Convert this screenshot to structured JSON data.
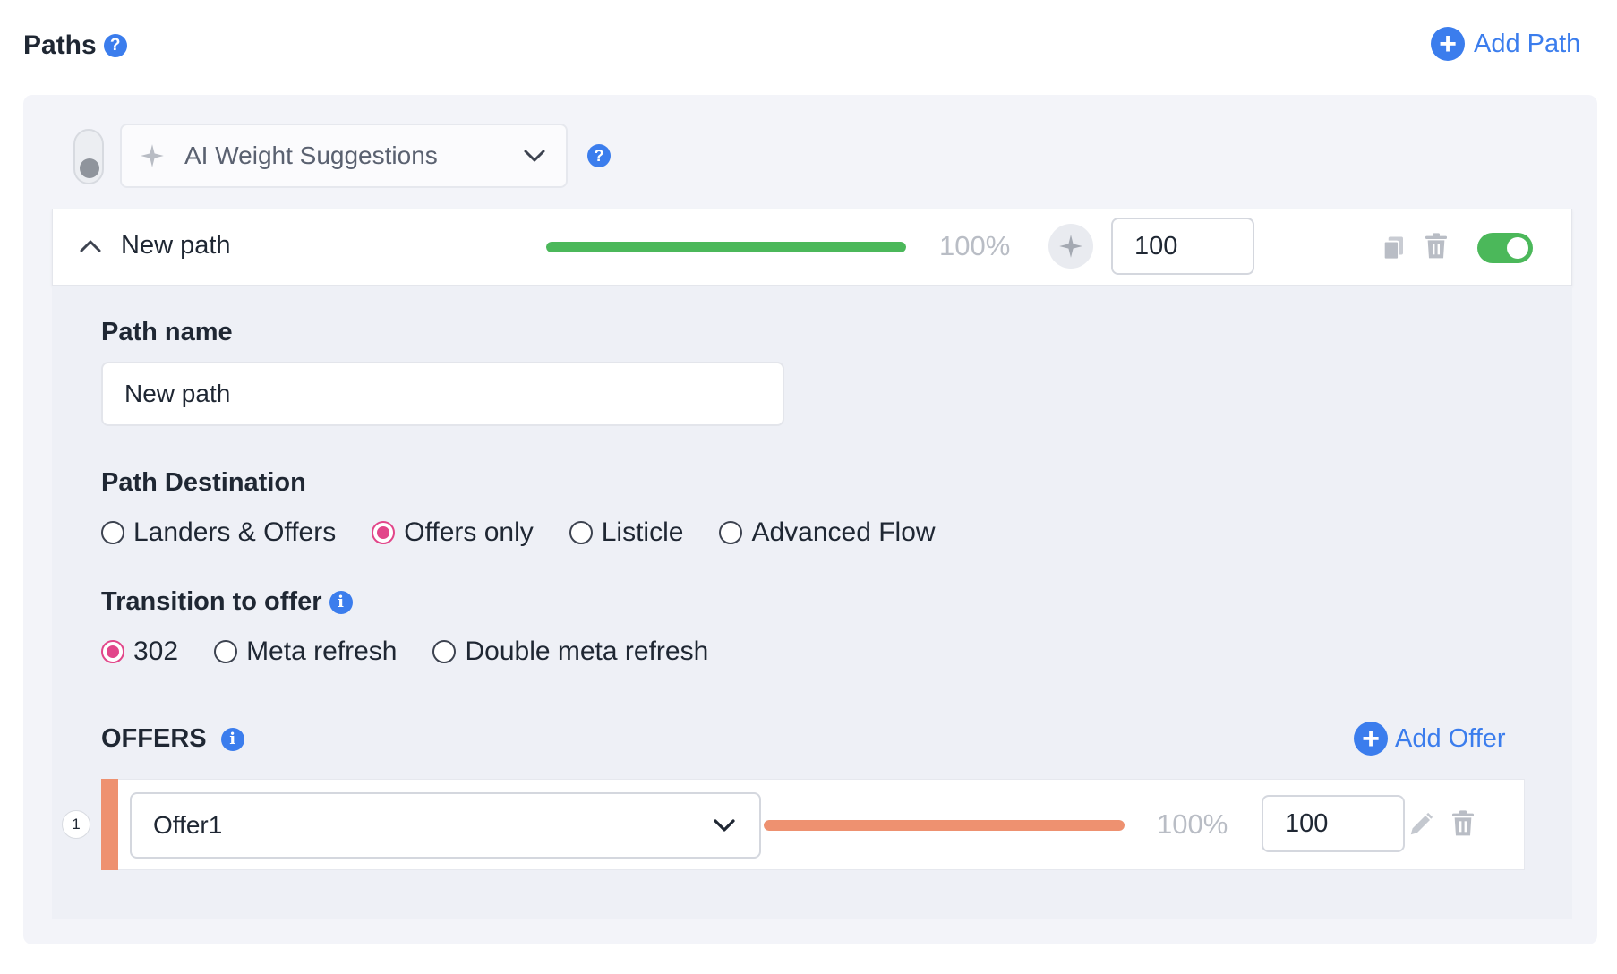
{
  "header": {
    "title": "Paths",
    "add_path_label": "Add Path"
  },
  "ai_weights": {
    "label": "AI Weight Suggestions",
    "enabled": false
  },
  "path": {
    "name": "New path",
    "weight_percent_label": "100%",
    "weight_value": "100",
    "weight_fraction": 1.0,
    "enabled": true,
    "bar_color": "#4bb85a"
  },
  "form": {
    "path_name_label": "Path name",
    "path_name_value": "New path",
    "destination_label": "Path Destination",
    "destination_options": [
      "Landers & Offers",
      "Offers only",
      "Listicle",
      "Advanced Flow"
    ],
    "destination_selected": "Offers only",
    "transition_label": "Transition to offer",
    "transition_options": [
      "302",
      "Meta refresh",
      "Double meta refresh"
    ],
    "transition_selected": "302"
  },
  "offers": {
    "label": "OFFERS",
    "add_offer_label": "Add Offer",
    "items": [
      {
        "index": "1",
        "name": "Offer1",
        "weight_percent_label": "100%",
        "weight_value": "100",
        "weight_fraction": 1.0,
        "color": "#ee9170"
      }
    ]
  },
  "colors": {
    "accent": "#3b7ded",
    "radio_selected": "#e2468a",
    "toggle_on": "#4bb85a"
  }
}
